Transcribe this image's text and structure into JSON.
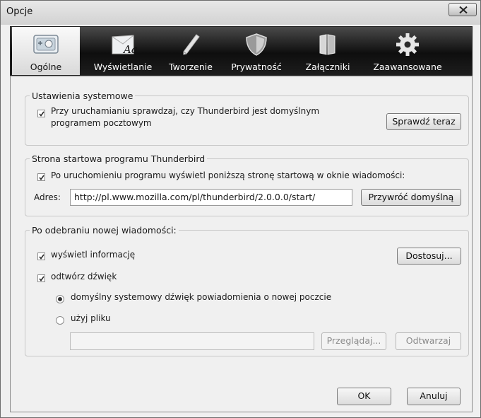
{
  "window": {
    "title": "Opcje"
  },
  "tabs": [
    {
      "label": "Ogólne",
      "icon": "general-icon",
      "active": true
    },
    {
      "label": "Wyświetlanie",
      "icon": "display-icon",
      "active": false
    },
    {
      "label": "Tworzenie",
      "icon": "pen-icon",
      "active": false
    },
    {
      "label": "Prywatność",
      "icon": "shield-icon",
      "active": false
    },
    {
      "label": "Załączniki",
      "icon": "attachments-icon",
      "active": false
    },
    {
      "label": "Zaawansowane",
      "icon": "gear-icon",
      "active": false
    }
  ],
  "system": {
    "legend": "Ustawienia systemowe",
    "check_line1": "Przy uruchamianiu sprawdzaj, czy Thunderbird jest domyślnym",
    "check_line2": "programem pocztowym",
    "check_checked": true,
    "button": "Sprawdź teraz"
  },
  "startpage": {
    "legend": "Strona startowa programu Thunderbird",
    "check_label": "Po uruchomieniu programu wyświetl poniższą stronę startową w oknie wiadomości:",
    "check_checked": true,
    "address_label": "Adres:",
    "address_value": "http://pl.www.mozilla.com/pl/thunderbird/2.0.0.0/start/",
    "restore_button": "Przywróć domyślną"
  },
  "newmail": {
    "legend": "Po odebraniu nowej wiadomości:",
    "alert_label": "wyświetl informację",
    "alert_checked": true,
    "customize_button": "Dostosuj...",
    "sound_label": "odtwórz dźwięk",
    "sound_checked": true,
    "radio_default": "domyślny systemowy dźwięk powiadomienia o nowej poczcie",
    "radio_file": "użyj pliku",
    "selected_radio": "default",
    "file_value": "",
    "browse_button": "Przeglądaj...",
    "play_button": "Odtwarzaj"
  },
  "footer": {
    "ok": "OK",
    "cancel": "Anuluj"
  }
}
